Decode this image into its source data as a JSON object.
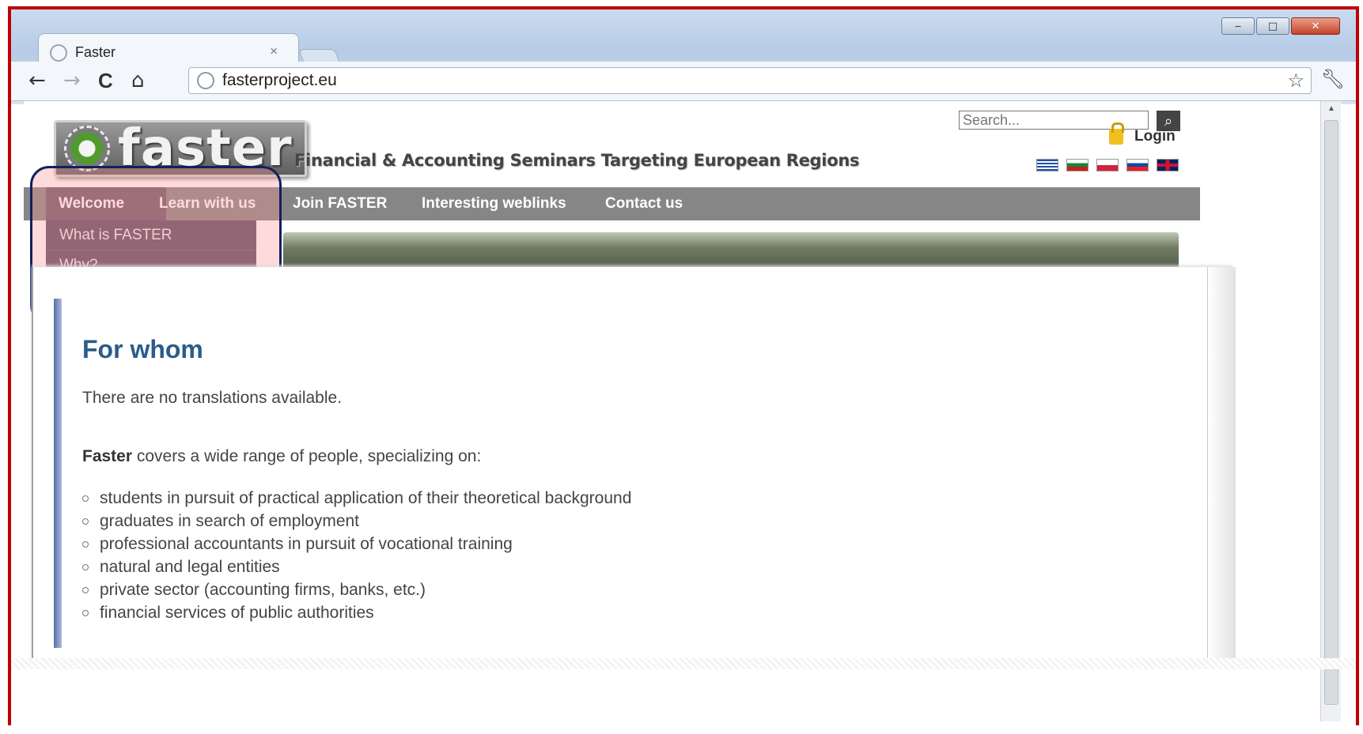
{
  "browser": {
    "tab_title": "Faster",
    "tab_close": "×",
    "url": "fasterproject.eu",
    "nav": {
      "back": "←",
      "forward": "→",
      "reload": "C",
      "home": "⌂"
    }
  },
  "site": {
    "logo_text": "faster",
    "tagline": "Financial & Accounting Seminars Targeting European Regions",
    "search_placeholder": "Search...",
    "login_label": "Login",
    "flags": [
      "greece",
      "bulgaria",
      "poland",
      "slovakia",
      "united-kingdom"
    ],
    "menu": [
      "Welcome",
      "Learn with us",
      "Join FASTER",
      "Interesting weblinks",
      "Contact us"
    ],
    "dropdown": [
      "What is FASTER",
      "Why?"
    ]
  },
  "content": {
    "title": "For whom",
    "note": "There are no translations available.",
    "intro_bold": "Faster",
    "intro_rest": " covers a wide range of people, specializing on:",
    "items": [
      "students in pursuit of practical application of their theoretical background",
      "graduates in search of employment",
      "professional accountants in pursuit of vocational training",
      "natural and legal entities",
      "private sector (accounting firms, banks, etc.)",
      "financial services of public authorities"
    ]
  },
  "colors": {
    "frame": "#c00000",
    "menubar": "#868686",
    "dropdown": "#5a4d66",
    "highlight_border": "#102060",
    "title": "#2a5d8a"
  }
}
